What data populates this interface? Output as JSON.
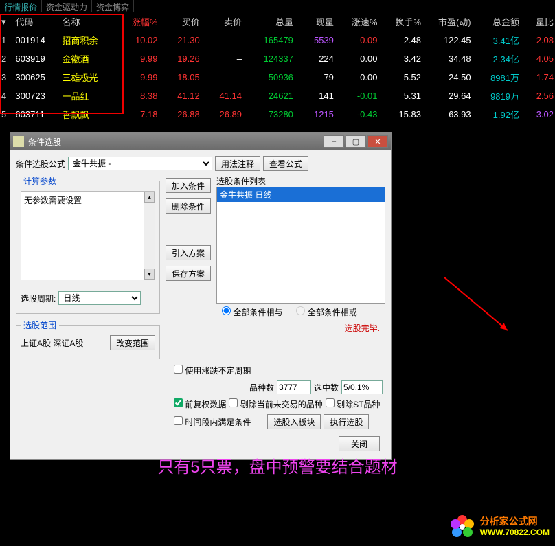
{
  "tabs": {
    "t1": "行情报价",
    "t2": "资金驱动力",
    "t3": "资金博弈"
  },
  "headers": [
    "",
    "代码",
    "名称",
    "涨幅%",
    "买价",
    "卖价",
    "总量",
    "现量",
    "涨速%",
    "换手%",
    "市盈(动)",
    "总金额",
    "量比"
  ],
  "rows": [
    {
      "idx": "1",
      "code": "001914",
      "name": "招商积余",
      "chg": "10.02",
      "bid": "21.30",
      "ask": "–",
      "vol": "165479",
      "cur": "5539",
      "speed": "0.09",
      "turn": "2.48",
      "pe": "122.45",
      "amt": "3.41亿",
      "amtCls": "c-cyan",
      "lb": "2.08",
      "lbCls": "c-red",
      "curCls": "c-purple"
    },
    {
      "idx": "2",
      "code": "603919",
      "name": "金徽酒",
      "chg": "9.99",
      "bid": "19.26",
      "ask": "–",
      "vol": "124337",
      "cur": "224",
      "speed": "0.00",
      "turn": "3.42",
      "pe": "34.48",
      "amt": "2.34亿",
      "amtCls": "c-cyan",
      "lb": "4.05",
      "lbCls": "c-red",
      "curCls": "c-white"
    },
    {
      "idx": "3",
      "code": "300625",
      "name": "三雄极光",
      "chg": "9.99",
      "bid": "18.05",
      "ask": "–",
      "vol": "50936",
      "cur": "79",
      "speed": "0.00",
      "turn": "5.52",
      "pe": "24.50",
      "amt": "8981万",
      "amtCls": "c-cyan",
      "lb": "1.74",
      "lbCls": "c-red",
      "curCls": "c-white"
    },
    {
      "idx": "4",
      "code": "300723",
      "name": "一品红",
      "chg": "8.38",
      "bid": "41.12",
      "ask": "41.14",
      "vol": "24621",
      "cur": "141",
      "speed": "-0.01",
      "turn": "5.31",
      "pe": "29.64",
      "amt": "9819万",
      "amtCls": "c-cyan",
      "lb": "2.56",
      "lbCls": "c-red",
      "curCls": "c-white"
    },
    {
      "idx": "5",
      "code": "603711",
      "name": "香飘飘",
      "chg": "7.18",
      "bid": "26.88",
      "ask": "26.89",
      "vol": "73280",
      "cur": "1215",
      "speed": "-0.43",
      "turn": "15.83",
      "pe": "63.93",
      "amt": "1.92亿",
      "amtCls": "c-cyan",
      "lb": "3.02",
      "lbCls": "c-purple",
      "curCls": "c-purple"
    }
  ],
  "dialog": {
    "title": "条件选股",
    "formula_label": "条件选股公式",
    "formula_value": "金牛共振       -",
    "usage_btn": "用法注释",
    "view_btn": "查看公式",
    "grp_calc": "计算参数",
    "no_param": "无参数需要设置",
    "period_label": "选股周期:",
    "period_value": "日线",
    "grp_scope": "选股范围",
    "scope_text": "上证A股  深证A股",
    "change_scope": "改变范围",
    "add_cond": "加入条件",
    "del_cond": "删除条件",
    "import_plan": "引入方案",
    "save_plan": "保存方案",
    "cond_list_label": "选股条件列表",
    "cond_item": "金牛共振  日线",
    "radio_and": "全部条件相与",
    "radio_or": "全部条件相或",
    "status": "选股完毕.",
    "chk_period": "使用涨跌不定周期",
    "kinds_label": "品种数",
    "kinds_val": "3777",
    "hits_label": "选中数",
    "hits_val": "5/0.1%",
    "chk_fuquan": "前复权数据",
    "chk_remove_nontrade": "剔除当前未交易的品种",
    "chk_remove_st": "剔除ST品种",
    "chk_time": "时间段内满足条件",
    "into_block": "选股入板块",
    "run": "执行选股",
    "close": "关闭"
  },
  "caption": "只有5只票，盘中预警要结合题材",
  "logo": {
    "l1": "分析家公式网",
    "l2": "WWW.70822.COM"
  }
}
